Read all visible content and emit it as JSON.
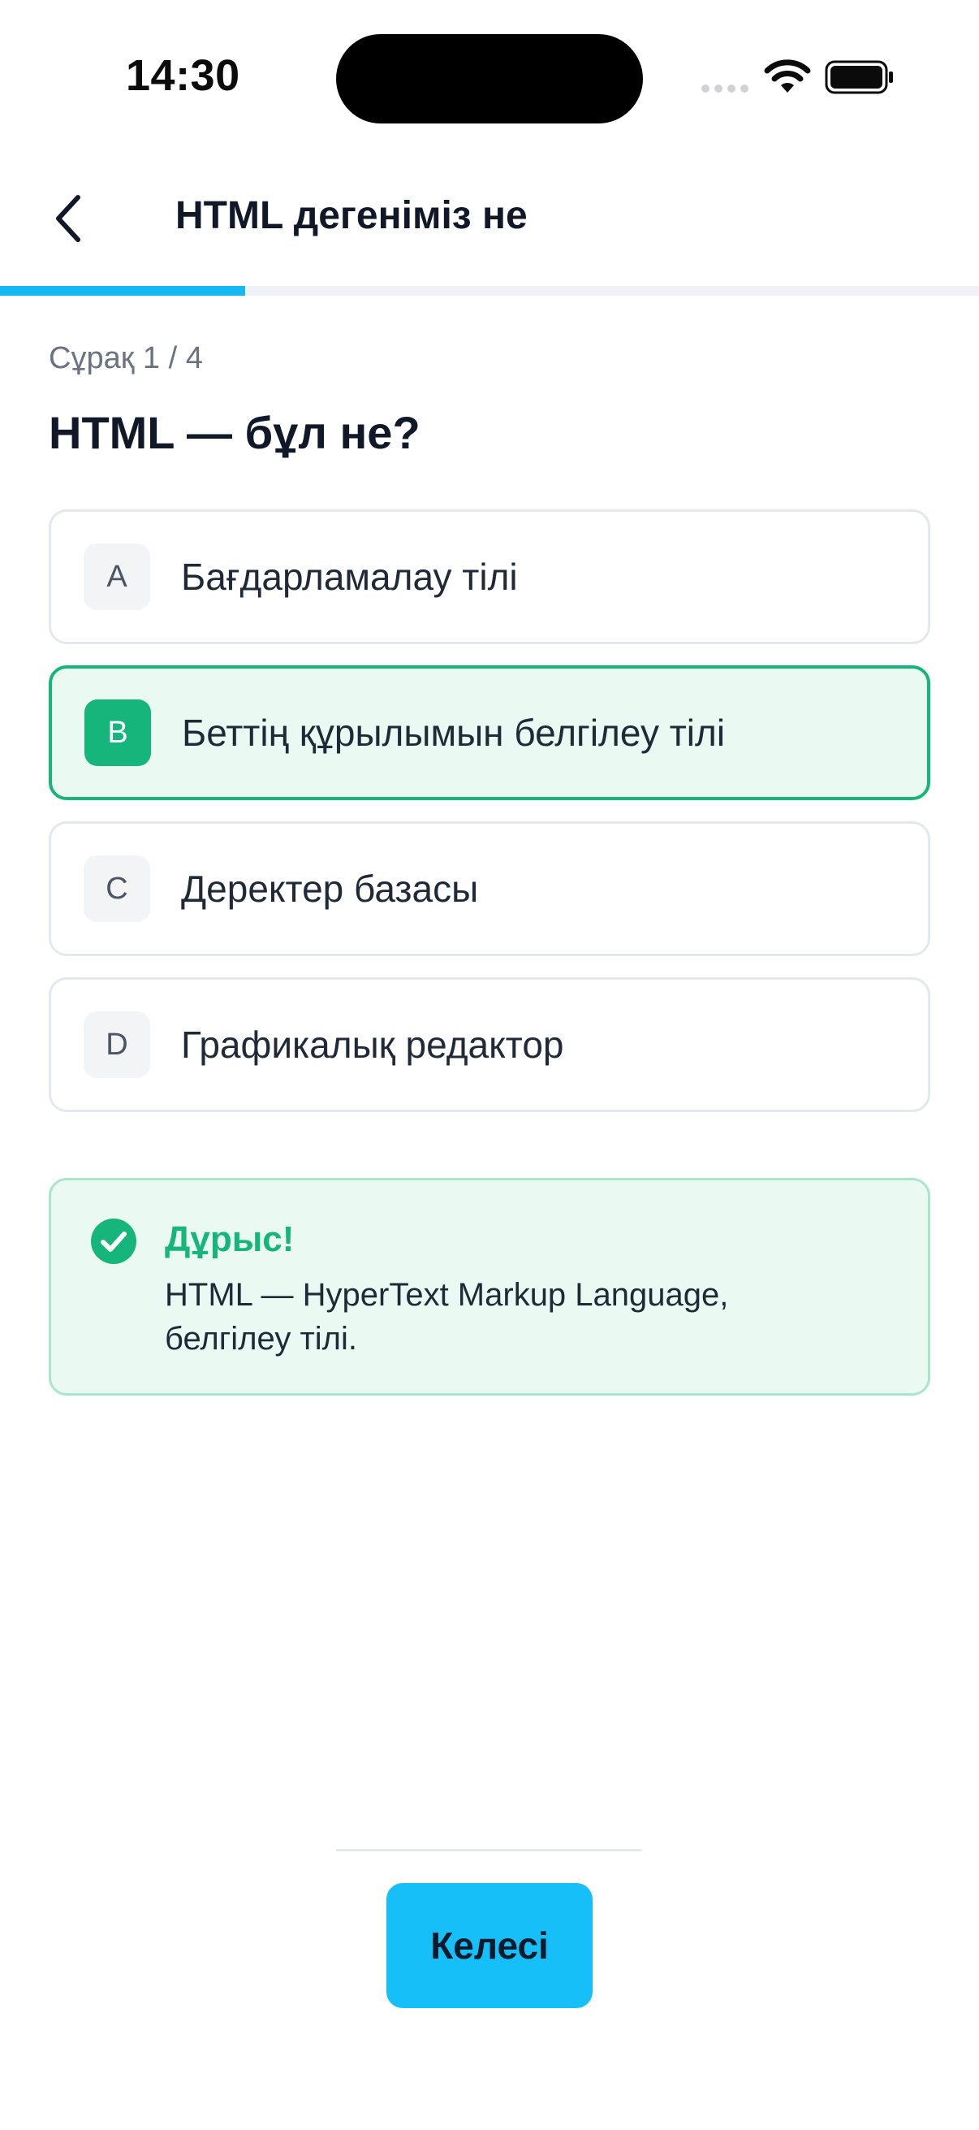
{
  "status_bar": {
    "time": "14:30",
    "icons": [
      "signal-dots-icon",
      "wifi-icon",
      "battery-icon"
    ]
  },
  "header": {
    "back_icon": "chevron-left-icon",
    "title": "HTML дегеніміз не"
  },
  "progress": {
    "current": 1,
    "total": 4,
    "fraction": 0.25,
    "color": "#16b8f4"
  },
  "question": {
    "counter": "Сұрақ 1 / 4",
    "text": "HTML — бұл не?"
  },
  "options": [
    {
      "letter": "A",
      "text": "Бағдарламалау тілі",
      "selected": false
    },
    {
      "letter": "B",
      "text": "Беттің құрылымын белгілеу тілі",
      "selected": true
    },
    {
      "letter": "C",
      "text": "Деректер базасы",
      "selected": false
    },
    {
      "letter": "D",
      "text": "Графикалық редактор",
      "selected": false
    }
  ],
  "feedback": {
    "icon": "check-circle-icon",
    "title": "Дұрыс!",
    "body": "HTML — HyperText Markup Language, белгілеу тілі.",
    "color": "#16b57c"
  },
  "footer": {
    "next_label": "Келесі",
    "button_color": "#16bff8"
  }
}
